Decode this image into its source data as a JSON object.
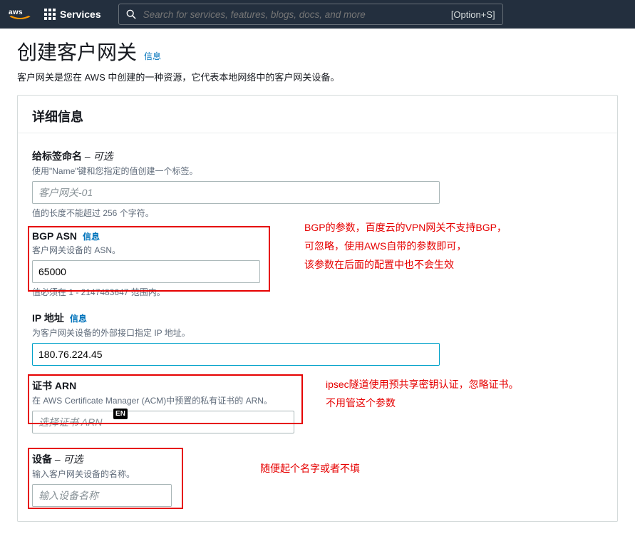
{
  "nav": {
    "services_label": "Services",
    "search_placeholder": "Search for services, features, blogs, docs, and more",
    "search_shortcut": "[Option+S]"
  },
  "page": {
    "title": "创建客户网关",
    "title_info": "信息",
    "description": "客户网关是您在 AWS 中创建的一种资源，它代表本地网络中的客户网关设备。"
  },
  "panel": {
    "heading": "详细信息"
  },
  "fields": {
    "name": {
      "label": "给标签命名",
      "optional": " – 可选",
      "help": "使用\"Name\"键和您指定的值创建一个标签。",
      "placeholder": "客户网关-01",
      "constraint": "值的长度不能超过 256 个字符。"
    },
    "bgp": {
      "label": "BGP ASN",
      "info": "信息",
      "help": "客户网关设备的 ASN。",
      "value": "65000",
      "constraint": "值必须在 1 - 2147483647 范围内。"
    },
    "ip": {
      "label": "IP 地址",
      "info": "信息",
      "help": "为客户网关设备的外部接口指定 IP 地址。",
      "value": "180.76.224.45"
    },
    "arn": {
      "label": "证书 ARN",
      "help": "在 AWS Certificate Manager (ACM)中预置的私有证书的 ARN。",
      "placeholder": "选择证书 ARN",
      "badge": "EN"
    },
    "device": {
      "label": "设备",
      "optional": " – 可选",
      "help": "输入客户网关设备的名称。",
      "placeholder": "输入设备名称"
    }
  },
  "annotations": {
    "bgp_note_l1": "BGP的参数，百度云的VPN网关不支持BGP，",
    "bgp_note_l2": "可忽略，使用AWS自带的参数即可，",
    "bgp_note_l3": "该参数在后面的配置中也不会生效",
    "arn_note_l1": "ipsec隧道使用预共享密钥认证，忽略证书。",
    "arn_note_l2": "不用管这个参数",
    "device_note": "随便起个名字或者不填"
  }
}
